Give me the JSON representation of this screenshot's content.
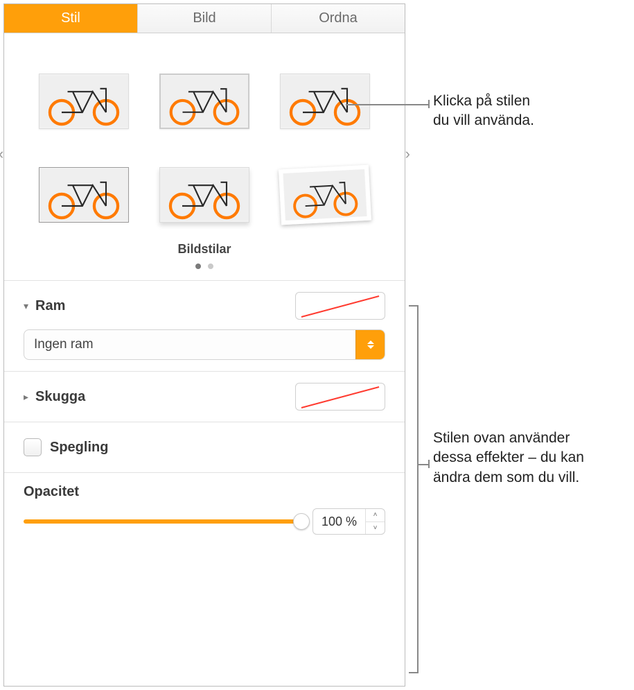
{
  "tabs": {
    "stil": "Stil",
    "bild": "Bild",
    "ordna": "Ordna"
  },
  "styles": {
    "label": "Bildstilar"
  },
  "ram": {
    "label": "Ram",
    "select_value": "Ingen ram"
  },
  "skugga": {
    "label": "Skugga"
  },
  "spegling": {
    "label": "Spegling",
    "checked": false
  },
  "opacitet": {
    "label": "Opacitet",
    "value_text": "100 %",
    "value": 100
  },
  "callouts": {
    "c1_line1": "Klicka på stilen",
    "c1_line2": "du vill använda.",
    "c2_line1": "Stilen ovan använder",
    "c2_line2": "dessa effekter – du kan",
    "c2_line3": "ändra dem som du vill."
  }
}
